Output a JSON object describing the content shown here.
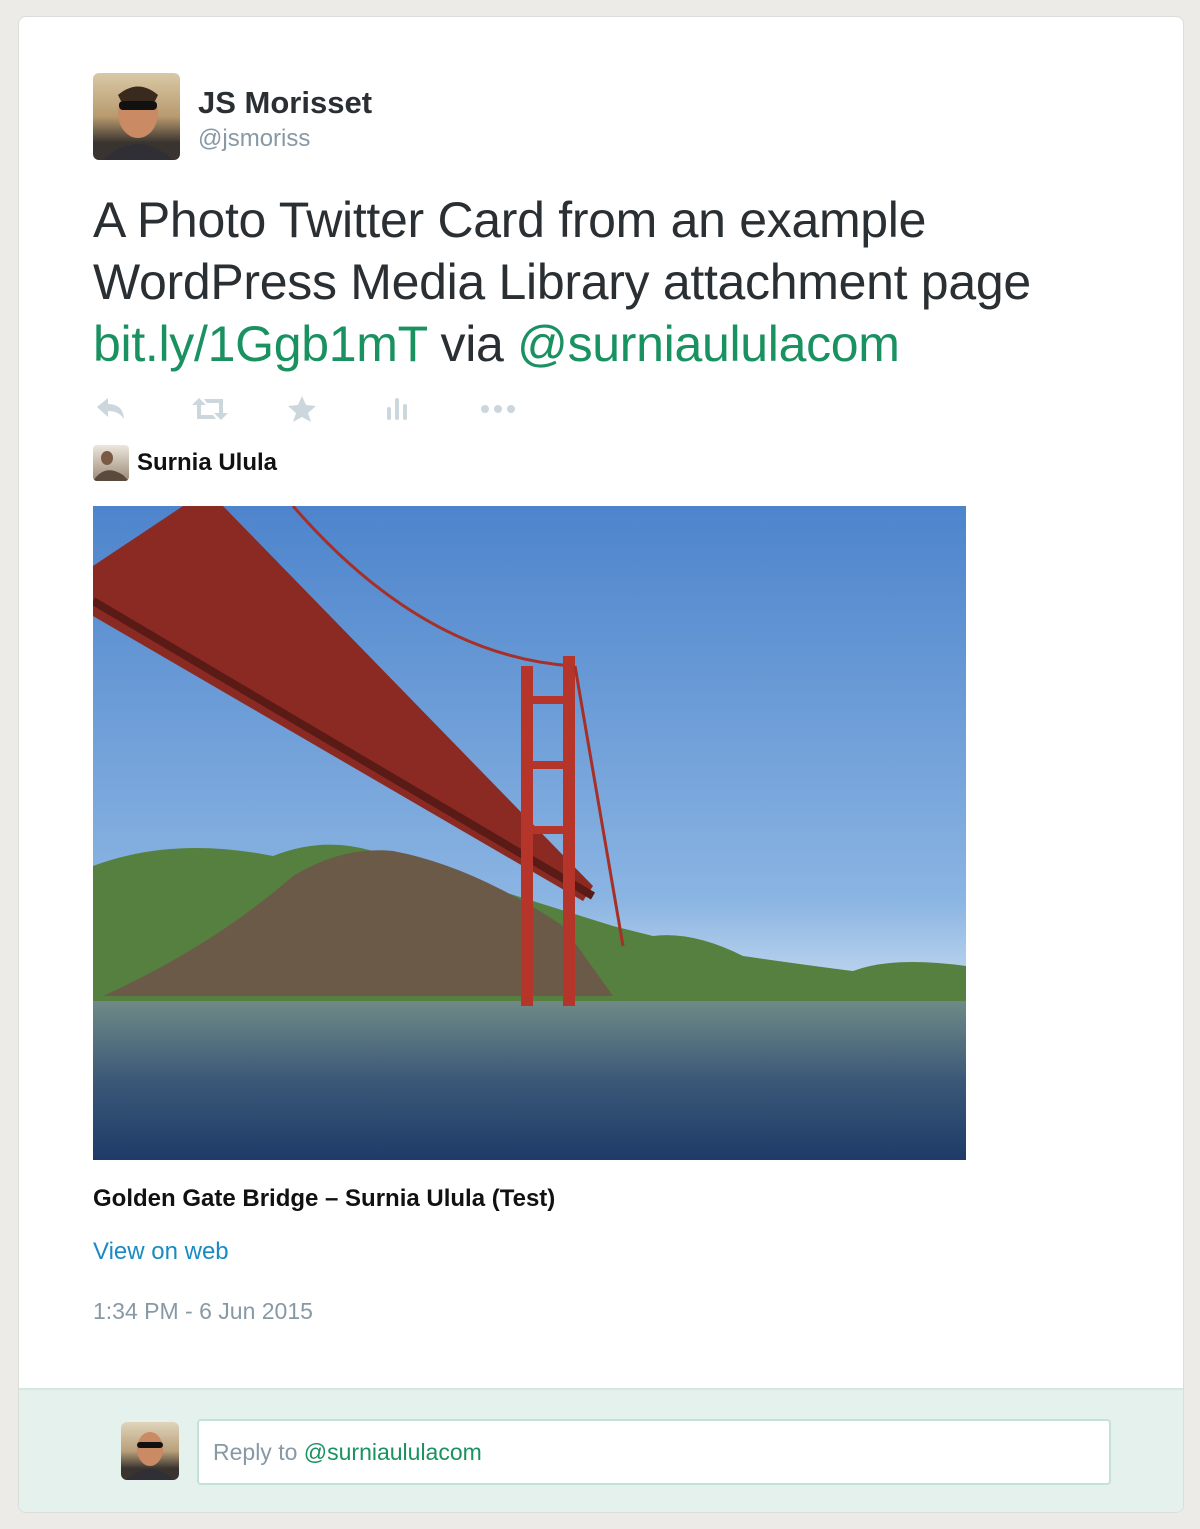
{
  "tweet": {
    "author_name": "JS Morisset",
    "author_handle": "@jsmoriss",
    "text": "A Photo Twitter Card from an example WordPress Media Library attachment page ",
    "link": "bit.ly/1Ggb1mT",
    "via": " via ",
    "mention": "@surniaululacom",
    "timestamp": "1:34 PM - 6 Jun 2015"
  },
  "actions": [
    {
      "icon": "reply-icon"
    },
    {
      "icon": "retweet-icon"
    },
    {
      "icon": "favorite-star-icon"
    },
    {
      "icon": "analytics-icon"
    },
    {
      "icon": "more-icon"
    }
  ],
  "card": {
    "site_name": "Surnia Ulula",
    "title": "Golden Gate Bridge – Surnia Ulula (Test)",
    "view_on_web": "View on web"
  },
  "reply": {
    "prefix": "Reply to ",
    "mention": "@surniaululacom"
  },
  "colors": {
    "link": "#1a9160",
    "icon": "#ccd6dd",
    "view_link": "#1a8ac4"
  }
}
